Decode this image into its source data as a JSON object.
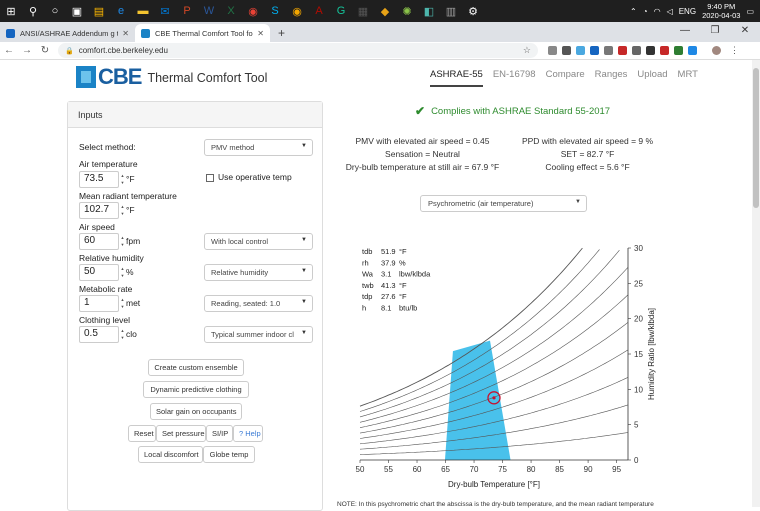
{
  "taskbar": {
    "icons": [
      {
        "name": "windows-start-icon",
        "glyph": "⊞",
        "color": "#ffffff"
      },
      {
        "name": "search-icon",
        "glyph": "⚲",
        "color": "#ffffff"
      },
      {
        "name": "cortana-icon",
        "glyph": "○",
        "color": "#ffffff"
      },
      {
        "name": "task-view-icon",
        "glyph": "▣",
        "color": "#ffffff"
      },
      {
        "name": "store-icon",
        "glyph": "▤",
        "color": "#ffb900"
      },
      {
        "name": "edge-icon",
        "glyph": "e",
        "color": "#1e88e5"
      },
      {
        "name": "file-explorer-icon",
        "glyph": "▬",
        "color": "#f4c430"
      },
      {
        "name": "mail-icon",
        "glyph": "✉",
        "color": "#0078d4"
      },
      {
        "name": "powerpoint-icon",
        "glyph": "P",
        "color": "#d24726"
      },
      {
        "name": "word-icon",
        "glyph": "W",
        "color": "#2b579a"
      },
      {
        "name": "excel-icon",
        "glyph": "X",
        "color": "#217346"
      },
      {
        "name": "chrome-icon",
        "glyph": "◉",
        "color": "#e94235"
      },
      {
        "name": "skype-icon",
        "glyph": "S",
        "color": "#00aff0"
      },
      {
        "name": "chrome-canary-icon",
        "glyph": "◉",
        "color": "#f2a600"
      },
      {
        "name": "acrobat-icon",
        "glyph": "A",
        "color": "#b30b00"
      },
      {
        "name": "grammarly-icon",
        "glyph": "G",
        "color": "#15c39a"
      },
      {
        "name": "film-icon",
        "glyph": "▦",
        "color": "#555555"
      },
      {
        "name": "app-icon",
        "glyph": "◆",
        "color": "#e8a317"
      },
      {
        "name": "app2-icon",
        "glyph": "✺",
        "color": "#8bc34a"
      },
      {
        "name": "app3-icon",
        "glyph": "◧",
        "color": "#4db6ac"
      },
      {
        "name": "app4-icon",
        "glyph": "▥",
        "color": "#9e9e9e"
      },
      {
        "name": "settings-icon",
        "glyph": "⚙",
        "color": "#ffffff"
      }
    ],
    "language": "ENG",
    "time": "9:40 PM",
    "date": "2020-04-03"
  },
  "tabs": [
    {
      "title": "ANSI/ASHRAE Addendum g to AN",
      "favicon_color": "#1565c0",
      "active": false
    },
    {
      "title": "CBE Thermal Comfort Tool for AS",
      "favicon_color": "#1a83c6",
      "active": true
    }
  ],
  "address": {
    "url": "comfort.cbe.berkeley.edu"
  },
  "site": {
    "logo_text": "CBE",
    "tool_title": "Thermal Comfort Tool",
    "nav": [
      "ASHRAE-55",
      "EN-16798",
      "Compare",
      "Ranges",
      "Upload",
      "MRT"
    ]
  },
  "inputs": {
    "heading": "Inputs",
    "method_label": "Select method:",
    "method_value": "PMV method",
    "air_temp_label": "Air temperature",
    "air_temp_value": "73.5",
    "air_temp_unit": "°F",
    "operative_label": "Use operative temp",
    "mrt_label": "Mean radiant temperature",
    "mrt_value": "102.7",
    "mrt_unit": "°F",
    "speed_label": "Air speed",
    "speed_value": "60",
    "speed_unit": "fpm",
    "speed_control": "With local control",
    "rh_label": "Relative humidity",
    "rh_value": "50",
    "rh_unit": "%",
    "rh_mode": "Relative humidity",
    "met_label": "Metabolic rate",
    "met_value": "1",
    "met_unit": "met",
    "met_activity": "Reading, seated: 1.0",
    "clo_label": "Clothing level",
    "clo_value": "0.5",
    "clo_unit": "clo",
    "clo_ensemble": "Typical summer indoor cl",
    "buttons": {
      "custom_ensemble": "Create custom ensemble",
      "dynamic_clothing": "Dynamic predictive clothing",
      "solar_gain": "Solar gain on occupants",
      "reset": "Reset",
      "set_pressure": "Set pressure",
      "si_ip": "SI/IP",
      "help": "? Help",
      "local_discomfort": "Local discomfort",
      "globe_temp": "Globe temp"
    }
  },
  "results": {
    "compliance": "Complies with ASHRAE Standard 55-2017",
    "pmv": "PMV with elevated air speed = 0.45",
    "ppd": "PPD with elevated air speed = 9 %",
    "sensation": "Sensation = Neutral",
    "set": "SET = 82.7 °F",
    "dry_bulb_still": "Dry-bulb temperature at still air = 67.9 °F",
    "cooling": "Cooling effect = 5.6 °F",
    "chart_select": "Psychrometric (air temperature)"
  },
  "chart_data": {
    "type": "line",
    "title": "",
    "xlabel": "Dry-bulb Temperature [°F]",
    "ylabel": "Humidity Ratio [lbw/klbda]",
    "xlim": [
      50,
      97
    ],
    "ylim": [
      0,
      30
    ],
    "x_ticks": [
      50,
      55,
      60,
      65,
      70,
      75,
      80,
      85,
      90,
      95
    ],
    "y_ticks": [
      0,
      5,
      10,
      15,
      20,
      25,
      30
    ],
    "rh_curves": [
      0.1,
      0.2,
      0.3,
      0.4,
      0.5,
      0.6,
      0.7,
      0.8,
      0.9,
      1.0
    ],
    "comfort_zone": [
      [
        64.9,
        0
      ],
      [
        76.4,
        0
      ],
      [
        72.8,
        16.9
      ],
      [
        66.3,
        15.4
      ]
    ],
    "comfort_color": "#29b6e8",
    "current_point": {
      "x": 73.5,
      "y": 8.8
    },
    "point_color": "#c8102e",
    "readout": [
      {
        "label": "tdb",
        "value": "51.9",
        "unit": "°F"
      },
      {
        "label": "rh",
        "value": "37.9",
        "unit": "%"
      },
      {
        "label": "Wa",
        "value": "3.1",
        "unit": "lbw/klbda"
      },
      {
        "label": "twb",
        "value": "41.3",
        "unit": "°F"
      },
      {
        "label": "tdp",
        "value": "27.6",
        "unit": "°F"
      },
      {
        "label": "h",
        "value": "8.1",
        "unit": "btu/lb"
      }
    ]
  },
  "note": "NOTE: In this psychrometric chart the abscissa is the dry-bulb temperature, and the mean radiant temperature"
}
